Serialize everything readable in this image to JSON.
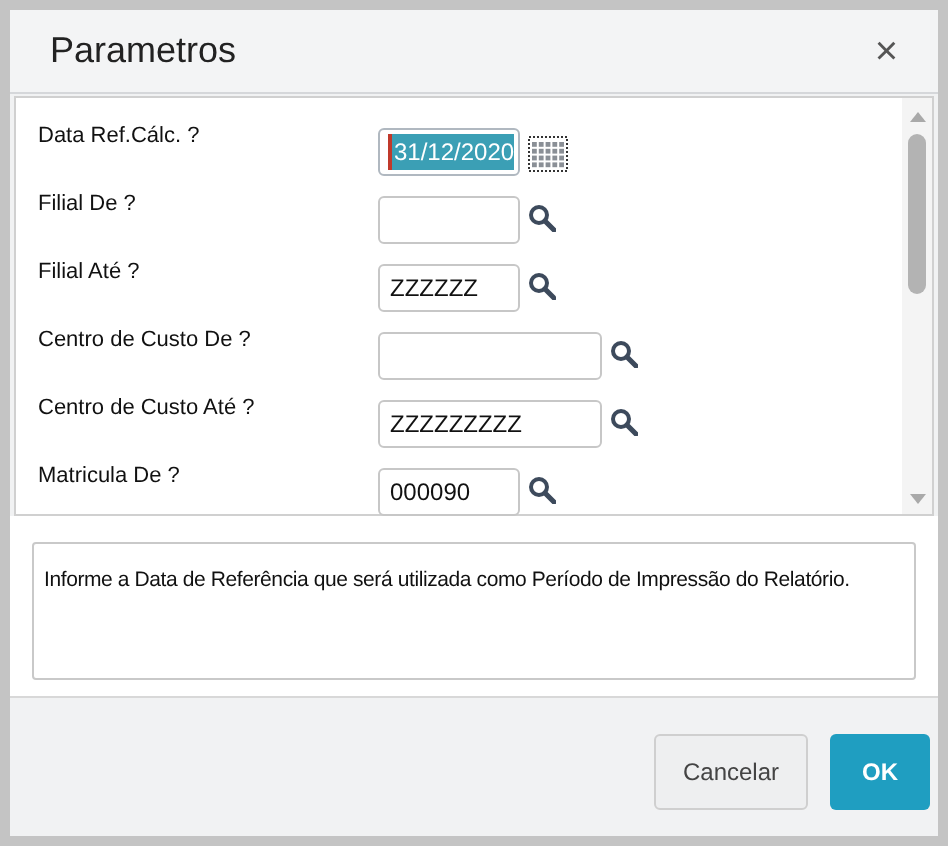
{
  "dialog": {
    "title": "Parametros",
    "close": "×"
  },
  "fields": [
    {
      "label": "Data Ref.Cálc. ?",
      "value": "31/12/2020",
      "kind": "date",
      "highlighted": true
    },
    {
      "label": "Filial De ?",
      "kind": "lookup",
      "highlighted": false
    },
    {
      "label": "Filial Até ?",
      "value": "ZZZZZZ",
      "kind": "lookup",
      "highlighted": false
    },
    {
      "label": "Centro de Custo De ?",
      "kind": "lookup_wide",
      "highlighted": false
    },
    {
      "label": "Centro de Custo Até ?",
      "value": "ZZZZZZZZZ",
      "kind": "lookup_wide",
      "highlighted": false
    },
    {
      "label": "Matricula De ?",
      "value": "000090",
      "kind": "lookup",
      "highlighted": false
    }
  ],
  "help": "Informe a Data de Referência que será utilizada como Período de Impressão do Relatório.",
  "buttons": [
    {
      "label": "Cancelar",
      "kind": "secondary"
    },
    {
      "label": "OK",
      "kind": "primary"
    }
  ]
}
